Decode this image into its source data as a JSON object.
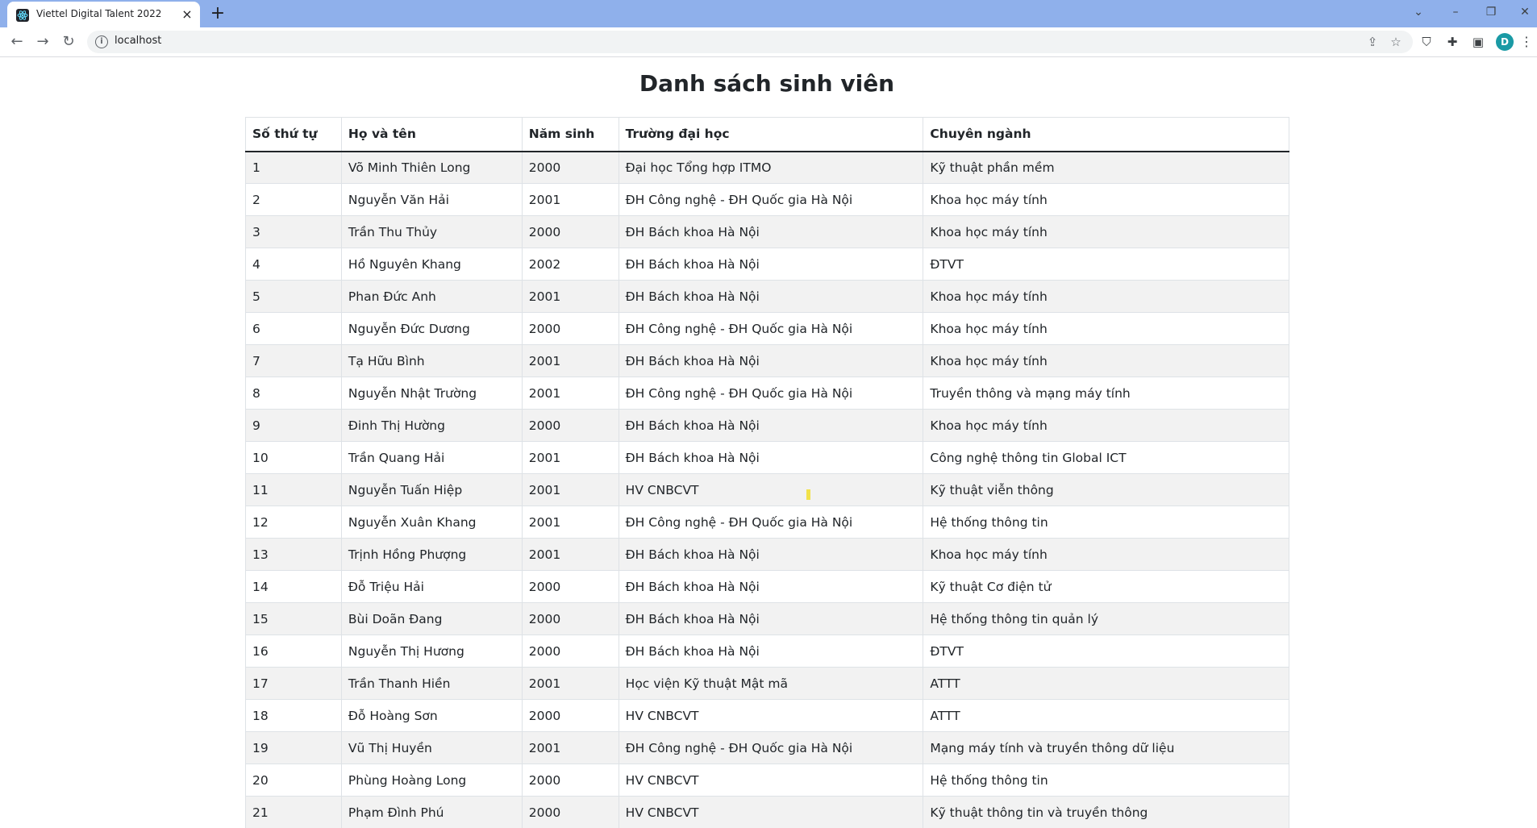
{
  "browser": {
    "tab_title": "Viettel Digital Talent 2022",
    "tab_close": "×",
    "new_tab": "+",
    "url": "localhost",
    "avatar_letter": "D"
  },
  "page": {
    "title": "Danh sách sinh viên"
  },
  "table": {
    "headers": [
      "Số thứ tự",
      "Họ và tên",
      "Năm sinh",
      "Trường đại học",
      "Chuyên ngành"
    ],
    "rows": [
      [
        "1",
        "Võ Minh Thiên Long",
        "2000",
        "Đại học Tổng hợp ITMO",
        "Kỹ thuật phần mềm"
      ],
      [
        "2",
        "Nguyễn Văn Hải",
        "2001",
        "ĐH Công nghệ - ĐH Quốc gia Hà Nội",
        "Khoa học máy tính"
      ],
      [
        "3",
        "Trần Thu Thủy",
        "2000",
        "ĐH Bách khoa Hà Nội",
        "Khoa học máy tính"
      ],
      [
        "4",
        "Hồ Nguyên Khang",
        "2002",
        "ĐH Bách khoa Hà Nội",
        "ĐTVT"
      ],
      [
        "5",
        "Phan Đức Anh",
        "2001",
        "ĐH Bách khoa Hà Nội",
        "Khoa học máy tính"
      ],
      [
        "6",
        "Nguyễn Đức Dương",
        "2000",
        "ĐH Công nghệ - ĐH Quốc gia Hà Nội",
        "Khoa học máy tính"
      ],
      [
        "7",
        "Tạ Hữu Bình",
        "2001",
        "ĐH Bách khoa Hà Nội",
        "Khoa học máy tính"
      ],
      [
        "8",
        "Nguyễn Nhật Trường",
        "2001",
        "ĐH Công nghệ - ĐH Quốc gia Hà Nội",
        "Truyền thông và mạng máy tính"
      ],
      [
        "9",
        "Đinh Thị Hường",
        "2000",
        "ĐH Bách khoa Hà Nội",
        "Khoa học máy tính"
      ],
      [
        "10",
        "Trần Quang Hải",
        "2001",
        "ĐH Bách khoa Hà Nội",
        "Công nghệ thông tin Global ICT"
      ],
      [
        "11",
        "Nguyễn Tuấn Hiệp",
        "2001",
        "HV CNBCVT",
        "Kỹ thuật viễn thông"
      ],
      [
        "12",
        "Nguyễn Xuân Khang",
        "2001",
        "ĐH Công nghệ - ĐH Quốc gia Hà Nội",
        "Hệ thống thông tin"
      ],
      [
        "13",
        "Trịnh Hồng Phượng",
        "2001",
        "ĐH Bách khoa Hà Nội",
        "Khoa học máy tính"
      ],
      [
        "14",
        "Đỗ Triệu Hải",
        "2000",
        "ĐH Bách khoa Hà Nội",
        "Kỹ thuật Cơ điện tử"
      ],
      [
        "15",
        "Bùi Doãn Đang",
        "2000",
        "ĐH Bách khoa Hà Nội",
        "Hệ thống thông tin quản lý"
      ],
      [
        "16",
        "Nguyễn Thị Hương",
        "2000",
        "ĐH Bách khoa Hà Nội",
        "ĐTVT"
      ],
      [
        "17",
        "Trần Thanh Hiền",
        "2001",
        "Học viện Kỹ thuật Mật mã",
        "ATTT"
      ],
      [
        "18",
        "Đỗ Hoàng Sơn",
        "2000",
        "HV CNBCVT",
        "ATTT"
      ],
      [
        "19",
        "Vũ Thị Huyền",
        "2001",
        "ĐH Công nghệ - ĐH Quốc gia Hà Nội",
        "Mạng máy tính và truyền thông dữ liệu"
      ],
      [
        "20",
        "Phùng Hoàng Long",
        "2000",
        "HV CNBCVT",
        "Hệ thống thông tin"
      ],
      [
        "21",
        "Phạm Đình Phú",
        "2000",
        "HV CNBCVT",
        "Kỹ thuật thông tin và truyền thông"
      ]
    ]
  }
}
